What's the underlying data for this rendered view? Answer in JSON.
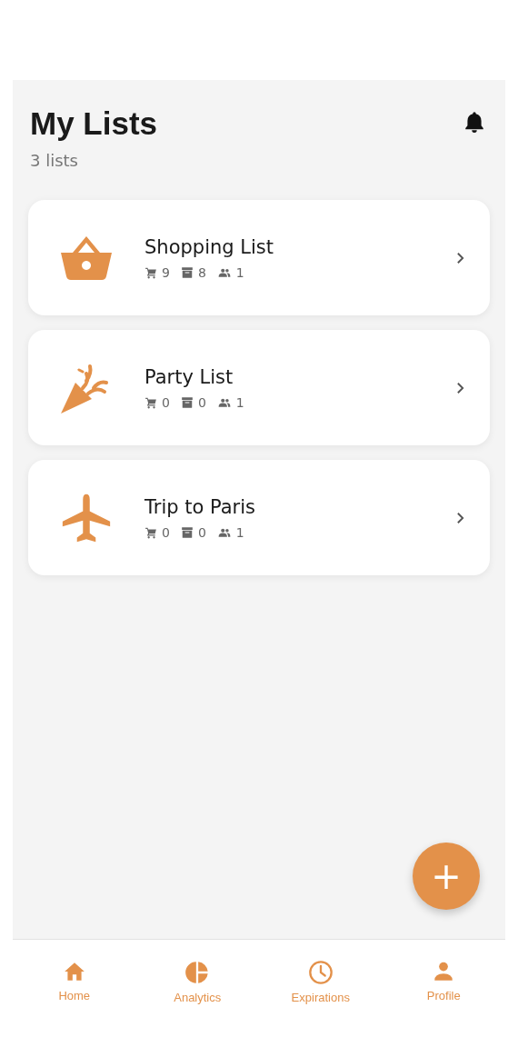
{
  "header": {
    "title": "My Lists",
    "subtitle": "3 lists"
  },
  "lists": [
    {
      "name": "Shopping List",
      "cart": "9",
      "archive": "8",
      "members": "1"
    },
    {
      "name": "Party List",
      "cart": "0",
      "archive": "0",
      "members": "1"
    },
    {
      "name": "Trip to Paris",
      "cart": "0",
      "archive": "0",
      "members": "1"
    }
  ],
  "fab": {
    "label": "+"
  },
  "nav": [
    {
      "label": "Home"
    },
    {
      "label": "Analytics"
    },
    {
      "label": "Expirations"
    },
    {
      "label": "Profile"
    }
  ]
}
